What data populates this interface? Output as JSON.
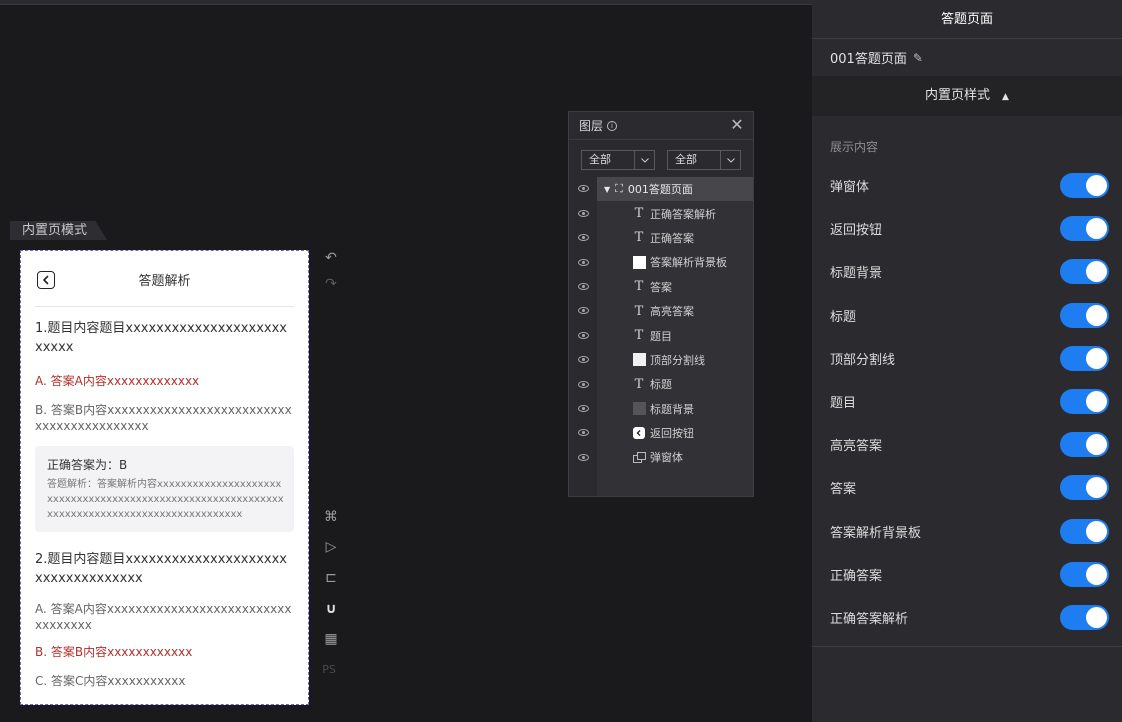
{
  "right_panel": {
    "tab": "答题页面",
    "page_name": "001答题页面",
    "section_title": "内置页样式",
    "subsection": "展示内容",
    "toggles": [
      {
        "label": "弹窗体",
        "on": true
      },
      {
        "label": "返回按钮",
        "on": true
      },
      {
        "label": "标题背景",
        "on": true
      },
      {
        "label": "标题",
        "on": true
      },
      {
        "label": "顶部分割线",
        "on": true
      },
      {
        "label": "题目",
        "on": true
      },
      {
        "label": "高亮答案",
        "on": true
      },
      {
        "label": "答案",
        "on": true
      },
      {
        "label": "答案解析背景板",
        "on": true
      },
      {
        "label": "正确答案",
        "on": true
      },
      {
        "label": "正确答案解析",
        "on": true
      }
    ]
  },
  "canvas": {
    "mode_tag": "内置页模式",
    "phone": {
      "title": "答题解析",
      "q1": {
        "title": "1.题目内容题目xxxxxxxxxxxxxxxxxxxxxxxxxx",
        "option_a": "A. 答案A内容xxxxxxxxxxxxx",
        "option_b": "B. 答案B内容xxxxxxxxxxxxxxxxxxxxxxxxxxxxxxxxxxxxxxxxxx",
        "correct": "正确答案为：B",
        "parse": "答题解析：答案解析内容xxxxxxxxxxxxxxxxxxxxxxxxxxxxxxxxxxxxxxxxxxxxxxxxxxxxxxxxxxxxxxxxxxxxxxxxxxxxxxxxxxxxxxxxxxxxxx"
      },
      "q2": {
        "title": "2.题目内容题目xxxxxxxxxxxxxxxxxxxxxxxxxxxxxxxxxxx",
        "option_a": "A. 答案A内容xxxxxxxxxxxxxxxxxxxxxxxxxxxxxxxxxx",
        "option_b": "B. 答案B内容xxxxxxxxxxxx",
        "option_c": "C. 答案C内容xxxxxxxxxxx"
      }
    }
  },
  "layers": {
    "title": "图层",
    "filter1": "全部",
    "filter2": "全部",
    "root": "001答题页面",
    "items": [
      {
        "label": "正确答案解析",
        "icon": "text-icon"
      },
      {
        "label": "正确答案",
        "icon": "text-icon"
      },
      {
        "label": "答案解析背景板",
        "icon": "rect-icon",
        "color": "#ffffff"
      },
      {
        "label": "答案",
        "icon": "text-icon"
      },
      {
        "label": "高亮答案",
        "icon": "text-icon"
      },
      {
        "label": "题目",
        "icon": "text-icon"
      },
      {
        "label": "顶部分割线",
        "icon": "rect-icon",
        "color": "#f0f0f0"
      },
      {
        "label": "标题",
        "icon": "text-icon"
      },
      {
        "label": "标题背景",
        "icon": "rect-icon",
        "color": "#555558"
      },
      {
        "label": "返回按钮",
        "icon": "back-icon"
      },
      {
        "label": "弹窗体",
        "icon": "group-icon"
      }
    ]
  },
  "colors": {
    "accent": "#1e7df1",
    "highlight_red": "#b3302b",
    "selection_dash": "#7b5cd6"
  }
}
